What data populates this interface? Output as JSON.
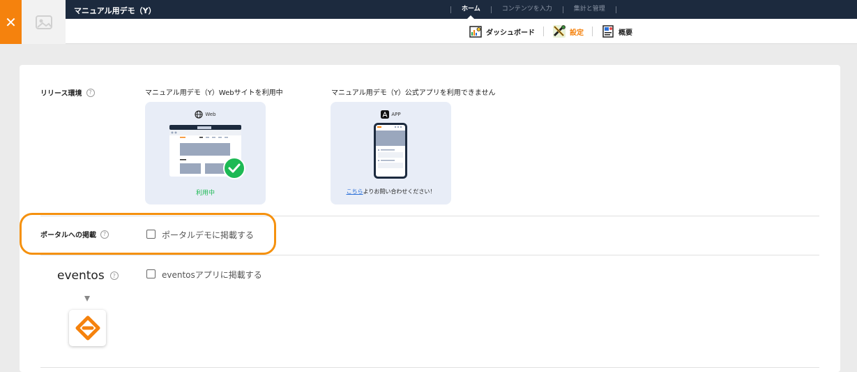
{
  "header": {
    "app_title": "マニュアル用デモ（Y）",
    "nav_tabs": [
      {
        "label": "ホーム",
        "active": true
      },
      {
        "label": "コンテンツを入力",
        "active": false
      },
      {
        "label": "集計と管理",
        "active": false
      }
    ],
    "sub_tabs": [
      {
        "label": "ダッシュボード",
        "icon": "dashboard-icon",
        "active": false
      },
      {
        "label": "設定",
        "icon": "settings-tools-icon",
        "active": true
      },
      {
        "label": "概要",
        "icon": "overview-icon",
        "active": false
      }
    ]
  },
  "release": {
    "label": "リリース環境",
    "web": {
      "caption": "マニュアル用デモ（Y）Webサイトを利用中",
      "title": "Web",
      "status": "利用中"
    },
    "app": {
      "caption": "マニュアル用デモ（Y）公式アプリを利用できません",
      "title": "APP",
      "link": "こちら",
      "note": "よりお問い合わせください！"
    }
  },
  "portal": {
    "label": "ポータルへの掲載",
    "checkbox_label": "ポータルデモに掲載する",
    "checked": false
  },
  "eventos": {
    "label": "eventos",
    "checkbox_label": "eventosアプリに掲載する",
    "checked": false
  },
  "colors": {
    "accent": "#f5820d",
    "navbar": "#1c2a3e",
    "success": "#1db954",
    "highlight": "#f5910e"
  }
}
